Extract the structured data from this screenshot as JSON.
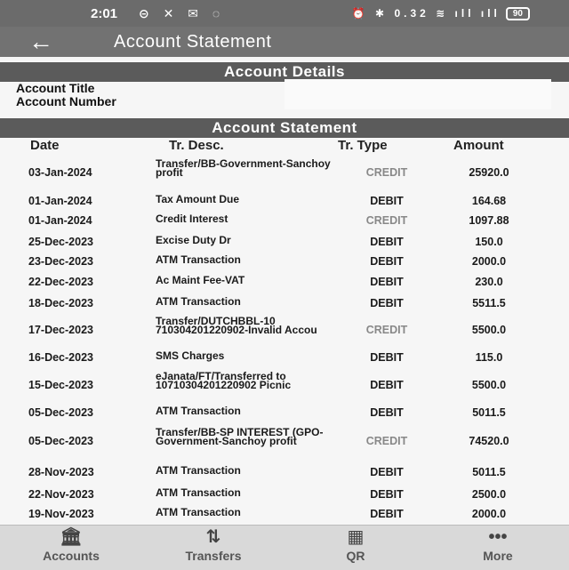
{
  "status_bar": {
    "time": "2:01",
    "left_icons": "⊝ ✕ ✉ ◌",
    "right_icons": "⏰ ✱ 0.32 ≋ ıll ıll",
    "battery": "90"
  },
  "app_bar": {
    "title": "Account Statement",
    "back_icon": "arrow-left-icon"
  },
  "account_details": {
    "header": "Account Details",
    "title_label": "Account Title",
    "number_label": "Account Number"
  },
  "statement": {
    "header": "Account Statement",
    "columns": {
      "date": "Date",
      "desc": "Tr. Desc.",
      "type": "Tr. Type",
      "amount": "Amount"
    },
    "rows": [
      {
        "date": "03-Jan-2024",
        "desc": "Transfer/BB-Government-Sanchoy profit",
        "type": "CREDIT",
        "amount": "25920.0"
      },
      {
        "date": "01-Jan-2024",
        "desc": "Tax Amount Due",
        "type": "DEBIT",
        "amount": "164.68"
      },
      {
        "date": "01-Jan-2024",
        "desc": "Credit Interest",
        "type": "CREDIT",
        "amount": "1097.88"
      },
      {
        "date": "25-Dec-2023",
        "desc": "Excise Duty Dr",
        "type": "DEBIT",
        "amount": "150.0"
      },
      {
        "date": "23-Dec-2023",
        "desc": "ATM Transaction",
        "type": "DEBIT",
        "amount": "2000.0"
      },
      {
        "date": "22-Dec-2023",
        "desc": "Ac Maint Fee-VAT",
        "type": "DEBIT",
        "amount": "230.0"
      },
      {
        "date": "18-Dec-2023",
        "desc": "ATM Transaction",
        "type": "DEBIT",
        "amount": "5511.5"
      },
      {
        "date": "17-Dec-2023",
        "desc": "Transfer/DUTCHBBL-10 710304201220902-Invalid Accou",
        "type": "CREDIT",
        "amount": "5500.0"
      },
      {
        "date": "16-Dec-2023",
        "desc": "SMS Charges",
        "type": "DEBIT",
        "amount": "115.0"
      },
      {
        "date": "15-Dec-2023",
        "desc": "eJanata/FT/Transferred to 10710304201220902 Picnic",
        "type": "DEBIT",
        "amount": "5500.0"
      },
      {
        "date": "05-Dec-2023",
        "desc": "ATM Transaction",
        "type": "DEBIT",
        "amount": "5011.5"
      },
      {
        "date": "05-Dec-2023",
        "desc": "Transfer/BB-SP INTEREST (GPO-Government-Sanchoy profit",
        "type": "CREDIT",
        "amount": "74520.0"
      },
      {
        "date": "28-Nov-2023",
        "desc": "ATM Transaction",
        "type": "DEBIT",
        "amount": "5011.5"
      },
      {
        "date": "22-Nov-2023",
        "desc": "ATM Transaction",
        "type": "DEBIT",
        "amount": "2500.0"
      },
      {
        "date": "19-Nov-2023",
        "desc": "ATM Transaction",
        "type": "DEBIT",
        "amount": "2000.0"
      }
    ]
  },
  "bottom_nav": [
    {
      "label": "Accounts",
      "icon": "bank-icon"
    },
    {
      "label": "Transfers",
      "icon": "transfer-arrows-icon"
    },
    {
      "label": "QR",
      "icon": "qr-code-icon"
    },
    {
      "label": "More",
      "icon": "more-dots-icon"
    }
  ]
}
